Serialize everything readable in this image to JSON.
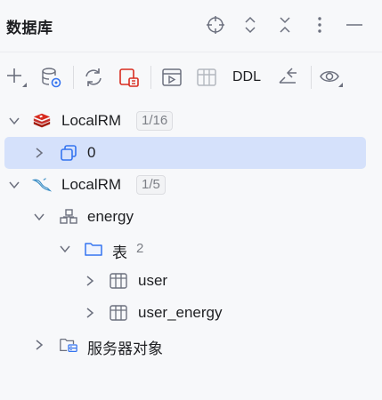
{
  "header": {
    "title": "数据库",
    "icons": [
      "crosshair-icon",
      "expand-all-icon",
      "collapse-all-icon",
      "more-vertical-icon",
      "minimize-icon"
    ]
  },
  "toolbar": {
    "ddl_label": "DDL",
    "icons": [
      "add-icon",
      "data-source-settings-icon",
      "refresh-icon",
      "disconnect-icon",
      "console-icon",
      "table-editor-icon",
      "ddl-button",
      "jump-to-query-icon",
      "view-options-icon"
    ]
  },
  "tree": {
    "nodes": [
      {
        "label": "LocalRM",
        "badge": "1/16",
        "icon": "redis-icon",
        "expanded": true
      },
      {
        "label": "0",
        "icon": "redis-database-icon",
        "expanded": false,
        "selected": true
      },
      {
        "label": "LocalRM",
        "badge": "1/5",
        "icon": "mysql-icon",
        "expanded": true
      },
      {
        "label": "energy",
        "icon": "schema-icon",
        "expanded": true
      },
      {
        "label": "表",
        "count": "2",
        "icon": "folder-icon",
        "expanded": true
      },
      {
        "label": "user",
        "icon": "table-icon",
        "expanded": false
      },
      {
        "label": "user_energy",
        "icon": "table-icon",
        "expanded": false
      },
      {
        "label": "服务器对象",
        "icon": "server-objects-icon",
        "expanded": false
      }
    ]
  },
  "colors": {
    "background": "#f7f8fa",
    "selection": "#d5e1fb",
    "redis": "#d82c20",
    "accent_blue": "#3574f0",
    "icon_gray": "#6c707e"
  }
}
